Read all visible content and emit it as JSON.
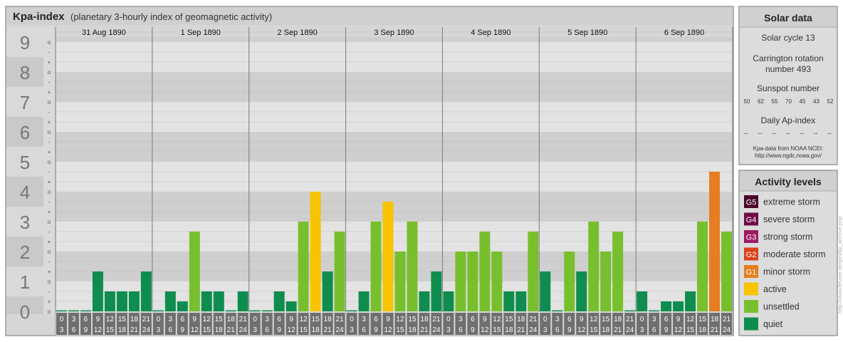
{
  "header": {
    "title": "Kpa-index",
    "subtitle": "(planetary 3-hourly index of geomagnetic activity)"
  },
  "side_label": "http://www.lfeuser.de/gml/kp_archive.php",
  "chart_data": {
    "type": "bar",
    "title": "Kpa-index",
    "subtitle": "(planetary 3-hourly index of geomagnetic activity)",
    "ylim": [
      0,
      9
    ],
    "y_ticks": [
      "0",
      "1",
      "2",
      "3",
      "4",
      "5",
      "6",
      "7",
      "8",
      "9"
    ],
    "y_minor_labels": [
      "o",
      "+",
      "-"
    ],
    "days": [
      "31 Aug 1890",
      "1 Sep 1890",
      "2 Sep 1890",
      "3 Sep 1890",
      "4 Sep 1890",
      "5 Sep 1890",
      "6 Sep 1890"
    ],
    "interval_start": [
      "0",
      "3",
      "6",
      "9",
      "12",
      "15",
      "18",
      "21"
    ],
    "interval_end": [
      "3",
      "6",
      "9",
      "12",
      "15",
      "18",
      "21",
      "24"
    ],
    "values": [
      [
        0,
        0,
        0,
        1.333,
        0.667,
        0.667,
        0.667,
        1.333
      ],
      [
        0,
        0.667,
        0.333,
        2.667,
        0.667,
        0.667,
        0,
        0.667
      ],
      [
        0,
        0,
        0.667,
        0.333,
        3,
        4,
        1.333,
        2.667
      ],
      [
        0,
        0.667,
        3,
        3.667,
        2,
        3,
        0.667,
        1.333
      ],
      [
        0.667,
        2,
        2,
        2.667,
        2,
        0.667,
        0.667,
        2.667
      ],
      [
        1.333,
        0,
        2,
        1.333,
        3,
        2,
        2.667,
        0
      ],
      [
        0.667,
        0,
        0.333,
        0.333,
        0.667,
        3,
        4.667,
        2.667
      ]
    ],
    "level_colors": {
      "quiet": "#0f8d4e",
      "unsettled": "#78bf2e",
      "active": "#f8c300",
      "minor": "#e57d21",
      "moderate": "#d9421c",
      "strong": "#9e1a63",
      "severe": "#700a48",
      "extreme": "#4a0529"
    }
  },
  "solar": {
    "title": "Solar data",
    "cycle": "Solar cycle 13",
    "carrington_line1": "Carrington rotation",
    "carrington_line2": "number 493",
    "sunspot_label": "Sunspot number",
    "sunspot_values": [
      "50",
      "62",
      "55",
      "70",
      "45",
      "43",
      "52"
    ],
    "ap_label": "Daily Ap-index",
    "ap_values": [
      "--",
      "--",
      "--",
      "--",
      "--",
      "--",
      "--"
    ],
    "source_line1": "Kpa-data from NOAA NCEI:",
    "source_line2": "http://www.ngdc.noaa.gov/"
  },
  "legend": {
    "title": "Activity levels",
    "items": [
      {
        "badge": "G5",
        "label": "extreme storm",
        "color": "#4a0529"
      },
      {
        "badge": "G4",
        "label": "severe storm",
        "color": "#700a48"
      },
      {
        "badge": "G3",
        "label": "strong storm",
        "color": "#9e1a63"
      },
      {
        "badge": "G2",
        "label": "moderate storm",
        "color": "#d9421c"
      },
      {
        "badge": "G1",
        "label": "minor storm",
        "color": "#e57d21"
      },
      {
        "badge": "",
        "label": "active",
        "color": "#f8c300"
      },
      {
        "badge": "",
        "label": "unsettled",
        "color": "#78bf2e"
      },
      {
        "badge": "",
        "label": "quiet",
        "color": "#0f8d4e"
      }
    ]
  }
}
